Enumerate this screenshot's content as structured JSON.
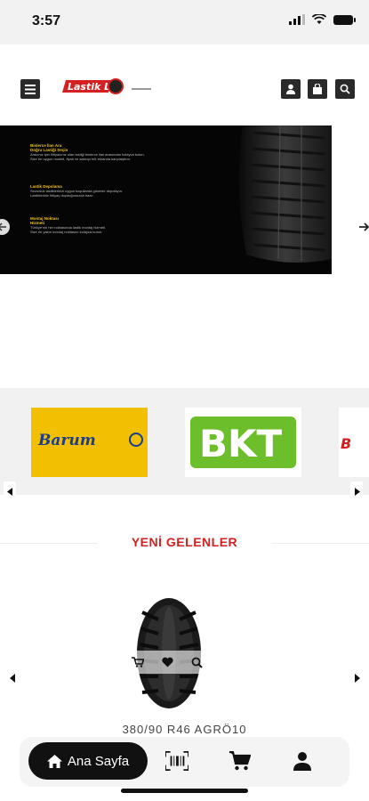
{
  "status_bar": {
    "time": "3:57"
  },
  "header": {
    "logo_text": "Lastik Let"
  },
  "slider": {
    "blocks": [
      {
        "heading_1": "Binlerce İlan Ara",
        "heading_2": "Doğru Lastiği Seçin",
        "text_1": "Aracınız için ihtiyacınız olan lastiği binlerce ilan arasından kolayca bulun.",
        "text_2": "Size en uygun modeli, fiyatı ve satıcıyı tek ekranda karşılaştırın."
      },
      {
        "heading_1": "Lastik Depolama",
        "heading_2": "",
        "text_1": "Sezonluk lastiklerinizi uygun koşullarda güvenle depolayın.",
        "text_2": "Lastikleriniz ihtiyaç duyduğunuzda hazır."
      },
      {
        "heading_1": "Montaj Noktası",
        "heading_2": "Hizmeti",
        "text_1": "Türkiye'nin her noktasında lastik montaj hizmeti.",
        "text_2": "Size en yakın montaj noktasını kolayca bulun."
      }
    ]
  },
  "brands": [
    {
      "name": "Barum",
      "bg": "#f2c000",
      "fg": "#1a3d8f"
    },
    {
      "name": "BKT",
      "bg": "#ffffff",
      "fg": "#6cbf2b"
    },
    {
      "name": "B",
      "bg": "#ffffff",
      "fg": "#d42020"
    }
  ],
  "section": {
    "title": "YENİ GELENLER"
  },
  "product": {
    "name": "380/90 R46 AGRÖ10"
  },
  "bottom_nav": {
    "home_label": "Ana Sayfa"
  },
  "colors": {
    "accent": "#d42020",
    "dark": "#111111"
  }
}
